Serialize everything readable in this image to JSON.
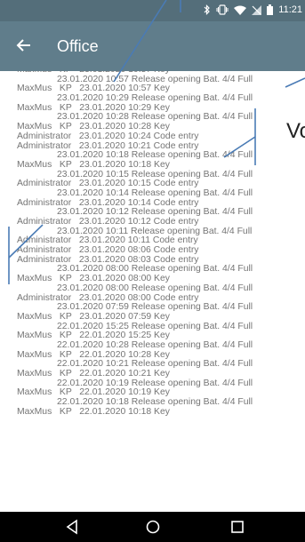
{
  "status": {
    "time": "11:21"
  },
  "appbar": {
    "title": "Office"
  },
  "overlay_text": "Vo",
  "log_lines": [
    {
      "t": "MaxMus   KP   23.01.2020 10:57 Key",
      "indent": false
    },
    {
      "t": "23.01.2020 10:57 Release opening Bat. 4/4 Full",
      "indent": true
    },
    {
      "t": "MaxMus   KP   23.01.2020 10:57 Key",
      "indent": false
    },
    {
      "t": "23.01.2020 10:29 Release opening Bat. 4/4 Full",
      "indent": true
    },
    {
      "t": "MaxMus   KP   23.01.2020 10:29 Key",
      "indent": false
    },
    {
      "t": "23.01.2020 10:28 Release opening Bat. 4/4 Full",
      "indent": true
    },
    {
      "t": "MaxMus   KP   23.01.2020 10:28 Key",
      "indent": false
    },
    {
      "t": "Administrator   23.01.2020 10:24 Code entry",
      "indent": false
    },
    {
      "t": "Administrator   23.01.2020 10:21 Code entry",
      "indent": false
    },
    {
      "t": "23.01.2020 10:18 Release opening Bat. 4/4 Full",
      "indent": true
    },
    {
      "t": "MaxMus   KP   23.01.2020 10:18 Key",
      "indent": false
    },
    {
      "t": "23.01.2020 10:15 Release opening Bat. 4/4 Full",
      "indent": true
    },
    {
      "t": "Administrator   23.01.2020 10:15 Code entry",
      "indent": false
    },
    {
      "t": "23.01.2020 10:14 Release opening Bat. 4/4 Full",
      "indent": true
    },
    {
      "t": "Administrator   23.01.2020 10:14 Code entry",
      "indent": false
    },
    {
      "t": "23.01.2020 10:12 Release opening Bat. 4/4 Full",
      "indent": true
    },
    {
      "t": "Administrator   23.01.2020 10:12 Code entry",
      "indent": false
    },
    {
      "t": "23.01.2020 10:11 Release opening Bat. 4/4 Full",
      "indent": true
    },
    {
      "t": "Administrator   23.01.2020 10:11 Code entry",
      "indent": false
    },
    {
      "t": "Administrator   23.01.2020 08:06 Code entry",
      "indent": false
    },
    {
      "t": "Administrator   23.01.2020 08:03 Code entry",
      "indent": false
    },
    {
      "t": "23.01.2020 08:00 Release opening Bat. 4/4 Full",
      "indent": true
    },
    {
      "t": "MaxMus   KP   23.01.2020 08:00 Key",
      "indent": false
    },
    {
      "t": "23.01.2020 08:00 Release opening Bat. 4/4 Full",
      "indent": true
    },
    {
      "t": "Administrator   23.01.2020 08:00 Code entry",
      "indent": false
    },
    {
      "t": "23.01.2020 07:59 Release opening Bat. 4/4 Full",
      "indent": true
    },
    {
      "t": "MaxMus   KP   23.01.2020 07:59 Key",
      "indent": false
    },
    {
      "t": "22.01.2020 15:25 Release opening Bat. 4/4 Full",
      "indent": true
    },
    {
      "t": "MaxMus   KP   22.01.2020 15:25 Key",
      "indent": false
    },
    {
      "t": "22.01.2020 10:28 Release opening Bat. 4/4 Full",
      "indent": true
    },
    {
      "t": "MaxMus   KP   22.01.2020 10:28 Key",
      "indent": false
    },
    {
      "t": "22.01.2020 10:21 Release opening Bat. 4/4 Full",
      "indent": true
    },
    {
      "t": "MaxMus   KP   22.01.2020 10:21 Key",
      "indent": false
    },
    {
      "t": "22.01.2020 10:19 Release opening Bat. 4/4 Full",
      "indent": true
    },
    {
      "t": "MaxMus   KP   22.01.2020 10:19 Key",
      "indent": false
    },
    {
      "t": "22.01.2020 10:18 Release opening Bat. 4/4 Full",
      "indent": true
    },
    {
      "t": "MaxMus   KP   22.01.2020 10:18 Key",
      "indent": false
    }
  ],
  "icons": {
    "status": [
      "bluetooth-icon",
      "vibrate-icon",
      "wifi-icon",
      "no-sim-icon",
      "battery-icon"
    ],
    "nav": [
      "back-triangle-icon",
      "home-circle-icon",
      "recents-square-icon"
    ]
  },
  "colors": {
    "statusbar": "#546E7A",
    "appbar": "#607D8B",
    "log_text": "#757575",
    "annotation_lines": "#4A7BB5"
  }
}
